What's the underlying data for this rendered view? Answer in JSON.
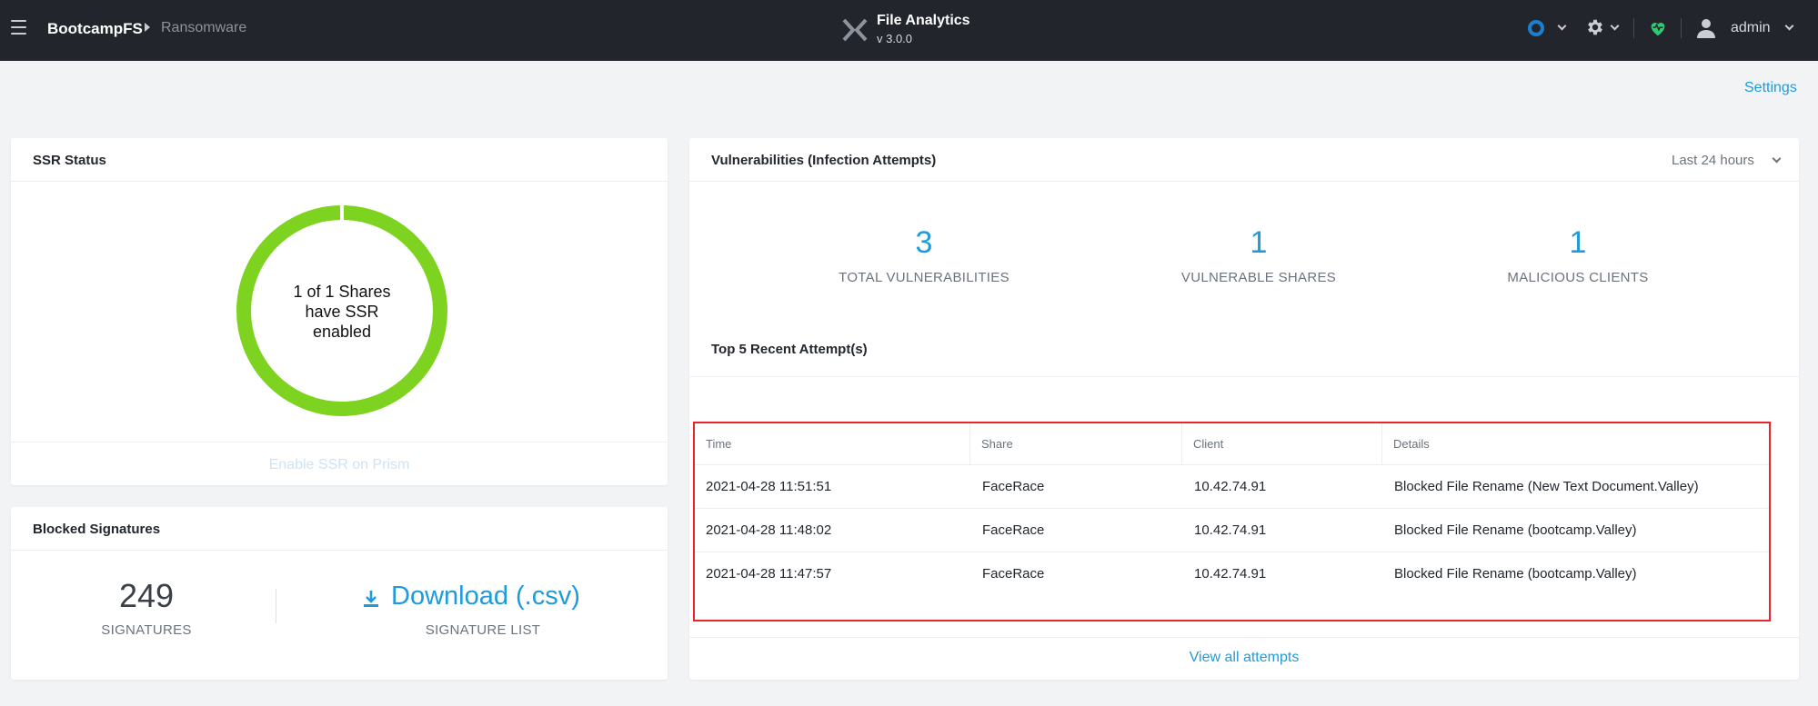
{
  "header": {
    "breadcrumb": [
      "BootcampFS",
      "Ransomware"
    ],
    "app_name": "File Analytics",
    "app_version": "v 3.0.0",
    "user": "admin",
    "icons": [
      "menu-icon",
      "app-logo-icon",
      "status-circle-icon",
      "gear-icon",
      "health-heart-icon",
      "user-icon"
    ]
  },
  "settings_link": "Settings",
  "ssr": {
    "title": "SSR Status",
    "donut_lines": [
      "1 of 1 Shares",
      "have SSR",
      "enabled"
    ],
    "enabled_fraction": 1.0,
    "enable_link": "Enable SSR on Prism",
    "colors": {
      "donut": "#7ed321"
    }
  },
  "signatures": {
    "title": "Blocked Signatures",
    "count": "249",
    "count_label": "SIGNATURES",
    "download_label": "Download (.csv)",
    "download_sub": "SIGNATURE LIST"
  },
  "vulnerabilities": {
    "title": "Vulnerabilities (Infection Attempts)",
    "range": "Last 24 hours",
    "stats": [
      {
        "value": "3",
        "label": "TOTAL VULNERABILITIES"
      },
      {
        "value": "1",
        "label": "VULNERABLE SHARES"
      },
      {
        "value": "1",
        "label": "MALICIOUS CLIENTS"
      }
    ],
    "recent_title": "Top 5 Recent Attempt(s)",
    "table": {
      "headers": [
        "Time",
        "Share",
        "Client",
        "Details"
      ],
      "rows": [
        [
          "2021-04-28 11:51:51",
          "FaceRace",
          "10.42.74.91",
          "Blocked File Rename (New Text Document.Valley)"
        ],
        [
          "2021-04-28 11:48:02",
          "FaceRace",
          "10.42.74.91",
          "Blocked File Rename (bootcamp.Valley)"
        ],
        [
          "2021-04-28 11:47:57",
          "FaceRace",
          "10.42.74.91",
          "Blocked File Rename (bootcamp.Valley)"
        ]
      ]
    },
    "view_all": "View all attempts"
  },
  "colors": {
    "accent": "#1f9bdc",
    "topbar": "#22262c",
    "highlight": "#e8252a",
    "health": "#2ecc71"
  }
}
